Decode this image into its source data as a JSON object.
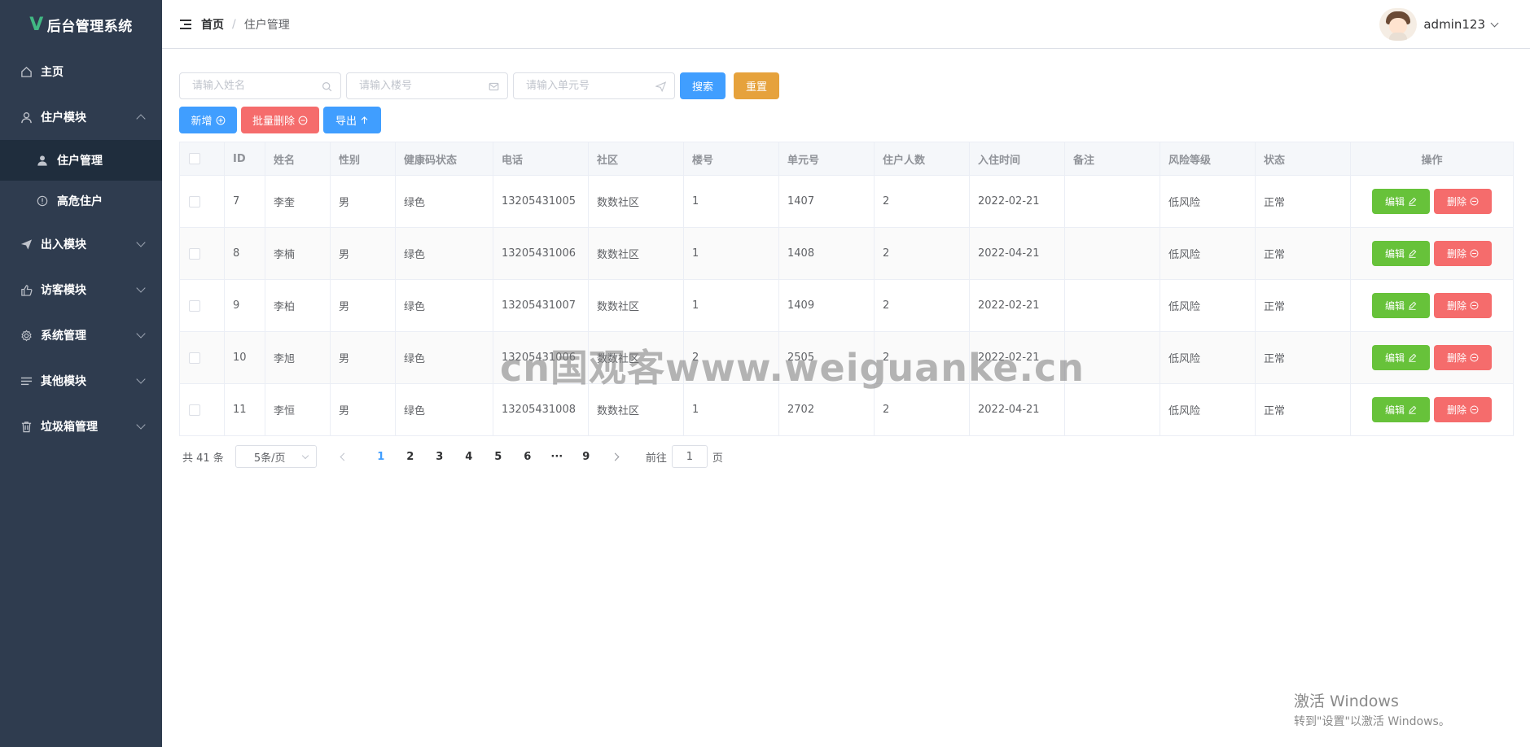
{
  "app": {
    "title": "后台管理系统",
    "logo_letter": "V"
  },
  "sidebar": {
    "items": [
      {
        "label": "主页",
        "icon": "home-icon"
      },
      {
        "label": "住户模块",
        "icon": "user-icon",
        "expanded": true,
        "children": [
          {
            "label": "住户管理",
            "icon": "user-solid-icon",
            "active": true
          },
          {
            "label": "高危住户",
            "icon": "warning-circle-icon"
          }
        ]
      },
      {
        "label": "出入模块",
        "icon": "paper-plane-icon"
      },
      {
        "label": "访客模块",
        "icon": "thumb-icon"
      },
      {
        "label": "系统管理",
        "icon": "gear-icon"
      },
      {
        "label": "其他模块",
        "icon": "list-icon"
      },
      {
        "label": "垃圾箱管理",
        "icon": "trash-icon"
      }
    ]
  },
  "header": {
    "breadcrumb": {
      "home": "首页",
      "separator": "/",
      "current": "住户管理"
    },
    "username": "admin123"
  },
  "filters": {
    "name_placeholder": "请输入姓名",
    "building_placeholder": "请输入楼号",
    "unit_placeholder": "请输入单元号",
    "search_label": "搜索",
    "reset_label": "重置"
  },
  "actions": {
    "add_label": "新增",
    "batch_delete_label": "批量删除",
    "export_label": "导出"
  },
  "table": {
    "columns": [
      "ID",
      "姓名",
      "性别",
      "健康码状态",
      "电话",
      "社区",
      "楼号",
      "单元号",
      "住户人数",
      "入住时间",
      "备注",
      "风险等级",
      "状态",
      "操作"
    ],
    "rows": [
      {
        "id": "7",
        "name": "李奎",
        "gender": "男",
        "health": "绿色",
        "phone": "13205431005",
        "community": "数数社区",
        "building": "1",
        "unit": "1407",
        "count": "2",
        "date": "2022-02-21",
        "note": "",
        "risk": "低风险",
        "status": "正常"
      },
      {
        "id": "8",
        "name": "李楠",
        "gender": "男",
        "health": "绿色",
        "phone": "13205431006",
        "community": "数数社区",
        "building": "1",
        "unit": "1408",
        "count": "2",
        "date": "2022-04-21",
        "note": "",
        "risk": "低风险",
        "status": "正常"
      },
      {
        "id": "9",
        "name": "李柏",
        "gender": "男",
        "health": "绿色",
        "phone": "13205431007",
        "community": "数数社区",
        "building": "1",
        "unit": "1409",
        "count": "2",
        "date": "2022-02-21",
        "note": "",
        "risk": "低风险",
        "status": "正常"
      },
      {
        "id": "10",
        "name": "李旭",
        "gender": "男",
        "health": "绿色",
        "phone": "13205431006",
        "community": "数数社区",
        "building": "2",
        "unit": "2505",
        "count": "2",
        "date": "2022-02-21",
        "note": "",
        "risk": "低风险",
        "status": "正常"
      },
      {
        "id": "11",
        "name": "李恒",
        "gender": "男",
        "health": "绿色",
        "phone": "13205431008",
        "community": "数数社区",
        "building": "1",
        "unit": "2702",
        "count": "2",
        "date": "2022-04-21",
        "note": "",
        "risk": "低风险",
        "status": "正常"
      }
    ],
    "edit_label": "编辑",
    "delete_label": "删除"
  },
  "pagination": {
    "total_text": "共 41 条",
    "page_size": "5条/页",
    "pages": [
      "1",
      "2",
      "3",
      "4",
      "5",
      "6",
      "···",
      "9"
    ],
    "current": "1",
    "goto_prefix": "前往",
    "goto_value": "1",
    "goto_suffix": "页"
  },
  "watermark": {
    "text": "cn国观客www.weiguanke.cn"
  },
  "windows_activation": {
    "line1": "激活 Windows",
    "line2": "转到\"设置\"以激活 Windows。"
  },
  "colors": {
    "sidebar_bg": "#2f3c4f",
    "primary": "#409eff",
    "success": "#67c23a",
    "danger": "#f56c6c",
    "warning": "#e6a23c",
    "logo": "#41b883"
  }
}
